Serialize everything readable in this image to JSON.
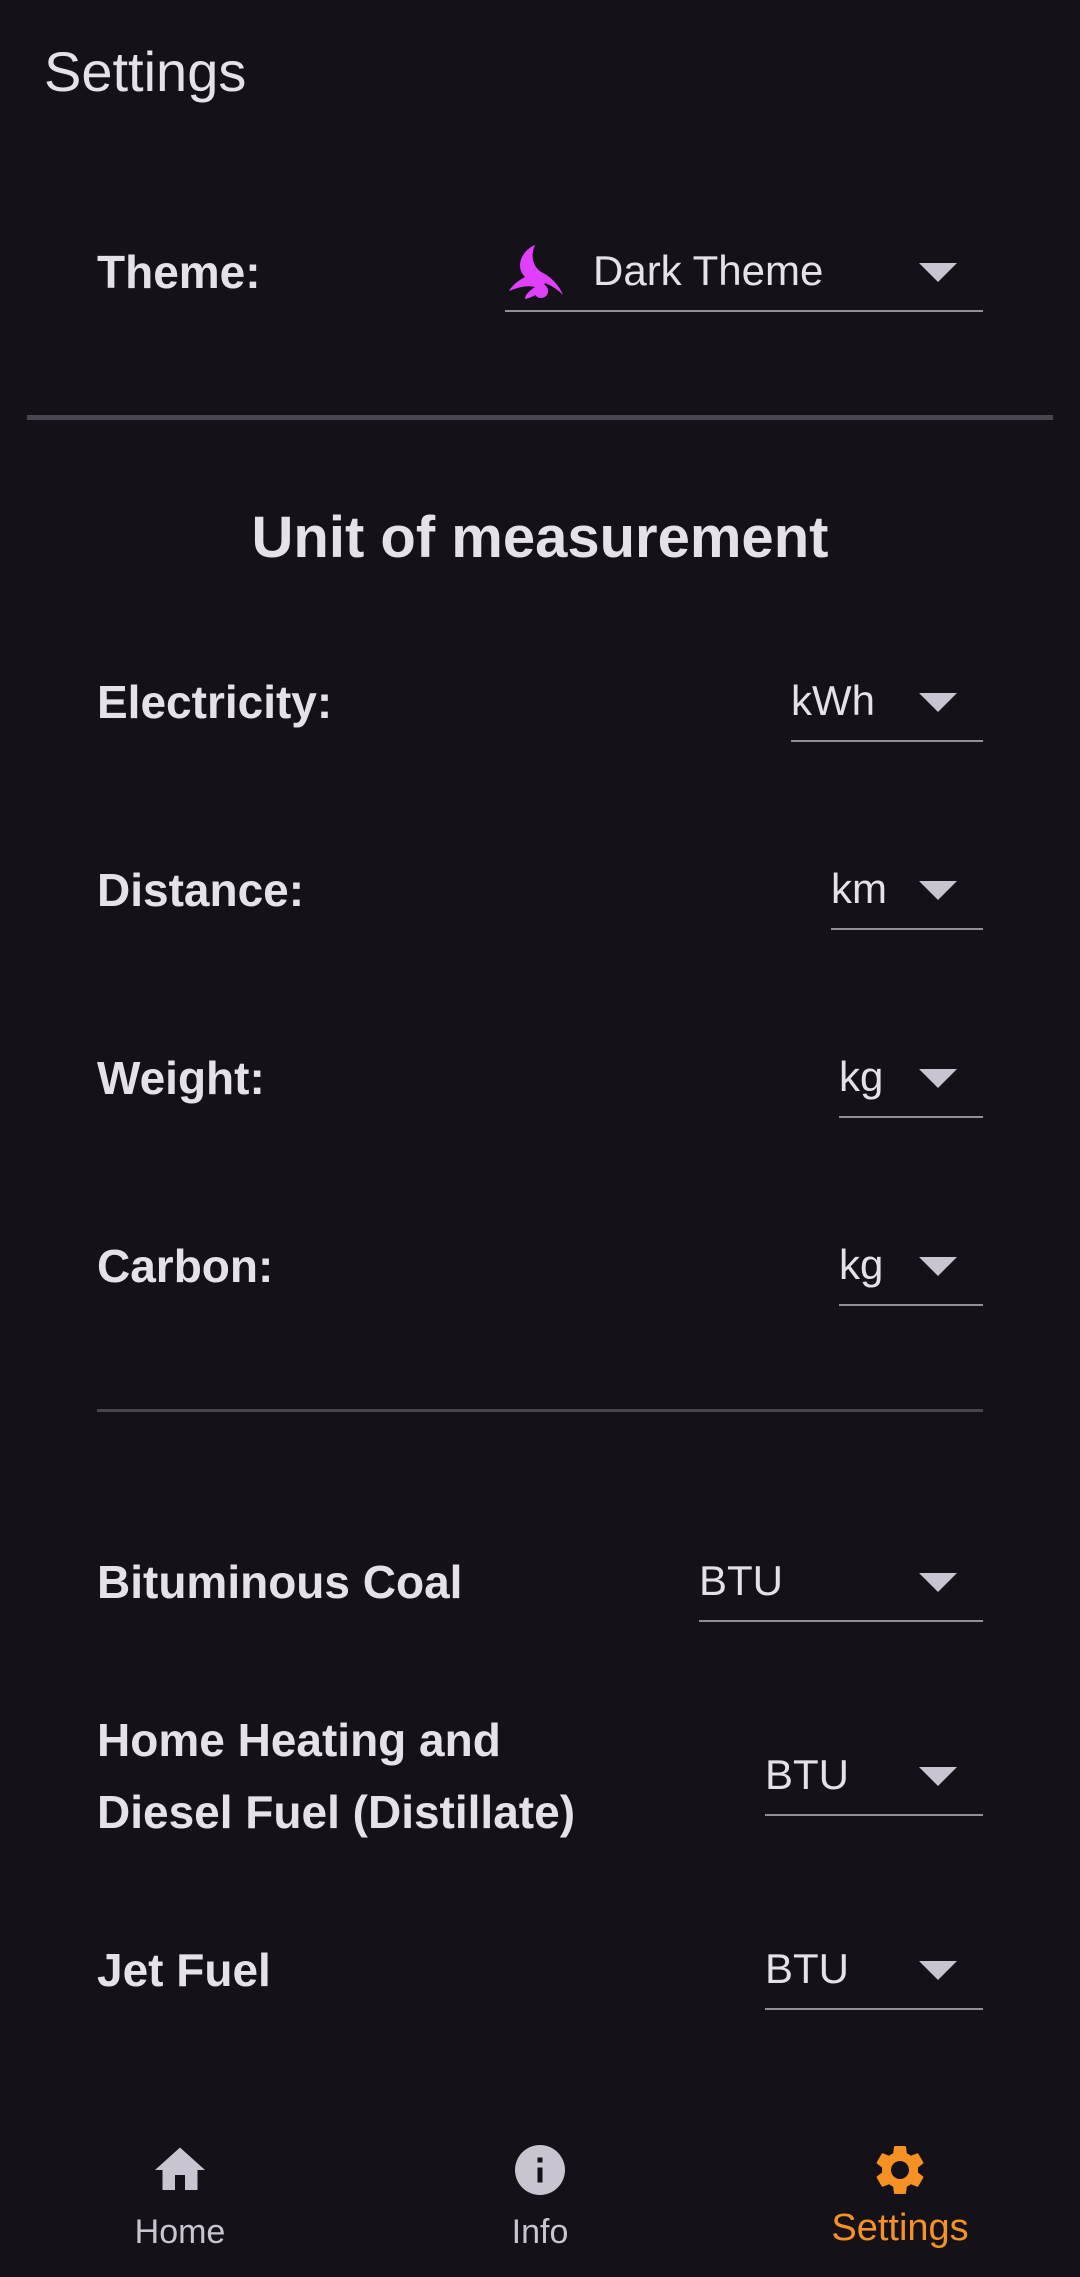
{
  "app_bar": {
    "title": "Settings"
  },
  "theme": {
    "label": "Theme:",
    "value": "Dark Theme",
    "icon": "moon-icon",
    "icon_color": "#e040fb"
  },
  "units": {
    "section_title": "Unit of measurement",
    "electricity": {
      "label": "Electricity:",
      "value": "kWh"
    },
    "distance": {
      "label": "Distance:",
      "value": "km"
    },
    "weight": {
      "label": "Weight:",
      "value": "kg"
    },
    "carbon": {
      "label": "Carbon:",
      "value": "kg"
    }
  },
  "fuels": {
    "bituminous_coal": {
      "label": "Bituminous Coal",
      "value": "BTU"
    },
    "home_heating": {
      "label_line1": "Home Heating and",
      "label_line2": "Diesel Fuel (Distillate)",
      "value": "BTU"
    },
    "jet_fuel": {
      "label": "Jet Fuel",
      "value": "BTU"
    }
  },
  "bottom_nav": {
    "items": [
      {
        "label": "Home",
        "icon": "home-icon"
      },
      {
        "label": "Info",
        "icon": "info-icon"
      },
      {
        "label": "Settings",
        "icon": "gear-icon",
        "active": true
      }
    ],
    "active_color": "#f59223",
    "inactive_color": "#cac4d0"
  },
  "colors": {
    "background": "#141218",
    "text": "#e6e0e9",
    "divider": "#49454f"
  }
}
